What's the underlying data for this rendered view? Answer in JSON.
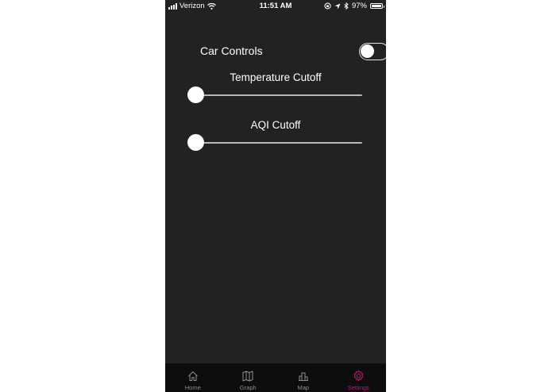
{
  "status_bar": {
    "carrier": "Verizon",
    "time": "11:51 AM",
    "battery_percent": "97%",
    "battery_level": 0.97
  },
  "settings": {
    "car_controls": {
      "label": "Car Controls",
      "enabled": false
    },
    "temperature_cutoff": {
      "label": "Temperature Cutoff",
      "value_fraction": 0
    },
    "aqi_cutoff": {
      "label": "AQI Cutoff",
      "value_fraction": 0
    }
  },
  "tabs": [
    {
      "label": "Home",
      "icon": "home-icon",
      "active": false
    },
    {
      "label": "Graph",
      "icon": "map-fold-icon",
      "active": false
    },
    {
      "label": "Map",
      "icon": "bar-chart-icon",
      "active": false
    },
    {
      "label": "Settings",
      "icon": "gear-icon",
      "active": true
    }
  ],
  "colors": {
    "background": "#222222",
    "tab_bar": "#0d0d0d",
    "active_tab": "#c8177b",
    "inactive_tab": "#8e8e8e"
  }
}
